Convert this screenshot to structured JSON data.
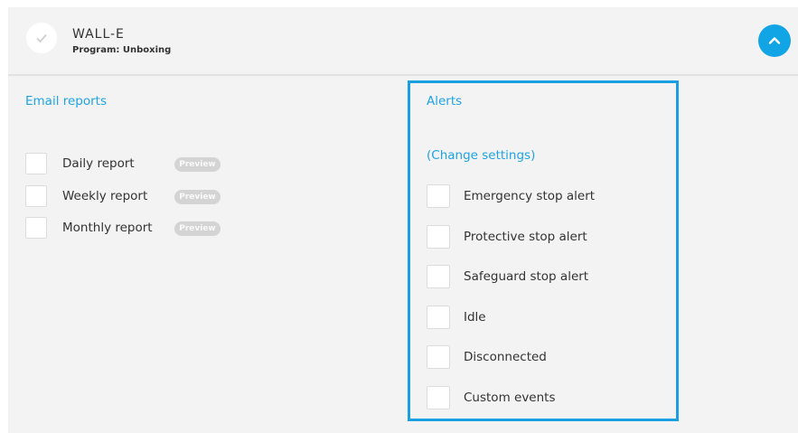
{
  "robot": {
    "name": "WALL-E",
    "program": "Program: Unboxing"
  },
  "email_reports": {
    "title": "Email reports",
    "items": [
      {
        "label": "Daily report",
        "badge": "Preview"
      },
      {
        "label": "Weekly report",
        "badge": "Preview"
      },
      {
        "label": "Monthly report",
        "badge": "Preview"
      }
    ]
  },
  "alerts": {
    "title": "Alerts",
    "change_link": "(Change settings)",
    "items": [
      {
        "label": "Emergency stop alert"
      },
      {
        "label": "Protective stop alert"
      },
      {
        "label": "Safeguard stop alert"
      },
      {
        "label": "Idle"
      },
      {
        "label": "Disconnected"
      },
      {
        "label": "Custom events"
      }
    ]
  },
  "colors": {
    "accent": "#12a5e6",
    "highlight_border": "#1a9fe0",
    "card_bg": "#f3f3f3"
  },
  "icons": {
    "avatar": "check-icon",
    "collapse": "chevron-up-icon"
  }
}
